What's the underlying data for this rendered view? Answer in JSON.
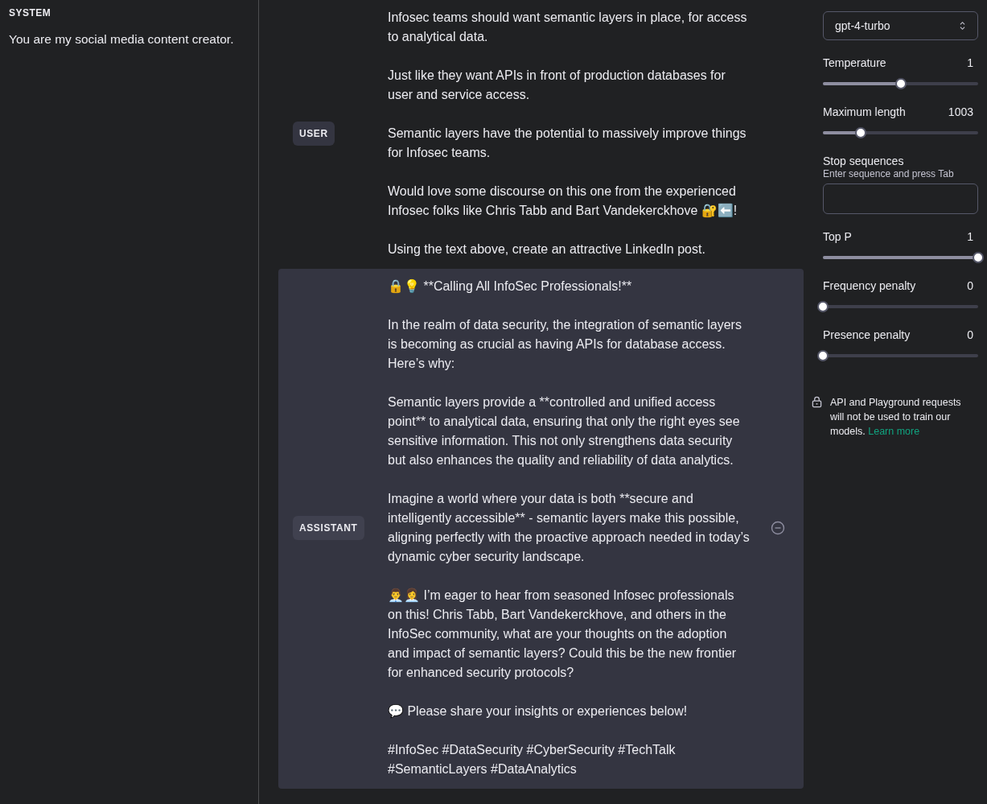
{
  "system": {
    "label": "SYSTEM",
    "text": "You are my social media content creator."
  },
  "messages": [
    {
      "role": "USER",
      "selected": false,
      "paragraphs": [
        "Infosec teams should want semantic layers in place, for access to analytical data.",
        "Just like they want APIs in front of production databases for user and service access.",
        "Semantic layers have the potential to massively improve things for Infosec teams.",
        "Would love some discourse on this one from the experienced Infosec folks like Chris Tabb and Bart Vandekerckhove 🔐⬅️!",
        "Using the text above, create an attractive LinkedIn post."
      ]
    },
    {
      "role": "ASSISTANT",
      "selected": true,
      "paragraphs": [
        "🔒💡 **Calling All InfoSec Professionals!**",
        "In the realm of data security, the integration of semantic layers is becoming as crucial as having APIs for database access. Here’s why:",
        "Semantic layers provide a **controlled and unified access point** to analytical data, ensuring that only the right eyes see sensitive information. This not only strengthens data security but also enhances the quality and reliability of data analytics.",
        "Imagine a world where your data is both **secure and intelligently accessible** - semantic layers make this possible, aligning perfectly with the proactive approach needed in today’s dynamic cyber security landscape.",
        "👨‍💼👩‍💼 I’m eager to hear from seasoned Infosec professionals on this! Chris Tabb, Bart Vandekerckhove, and others in the InfoSec community, what are your thoughts on the adoption and impact of semantic layers? Could this be the new frontier for enhanced security protocols?",
        "💬 Please share your insights or experiences below!",
        "#InfoSec #DataSecurity #CyberSecurity #TechTalk #SemanticLayers #DataAnalytics"
      ]
    }
  ],
  "settings": {
    "model": "gpt-4-turbo",
    "controls": [
      {
        "kind": "slider",
        "label": "Temperature",
        "reading": "1",
        "level": 0.5
      },
      {
        "kind": "slider",
        "label": "Maximum length",
        "reading": "1003",
        "level": 0.245
      },
      {
        "kind": "field",
        "label": "Stop sequences",
        "hint": "Enter sequence and press Tab"
      },
      {
        "kind": "slider",
        "label": "Top P",
        "reading": "1",
        "level": 1
      },
      {
        "kind": "slider",
        "label": "Frequency penalty",
        "reading": "0",
        "level": 0
      },
      {
        "kind": "slider",
        "label": "Presence penalty",
        "reading": "0",
        "level": 0
      }
    ],
    "notice": "API and Playground requests will not be used to train our models.",
    "link": "Learn more"
  }
}
